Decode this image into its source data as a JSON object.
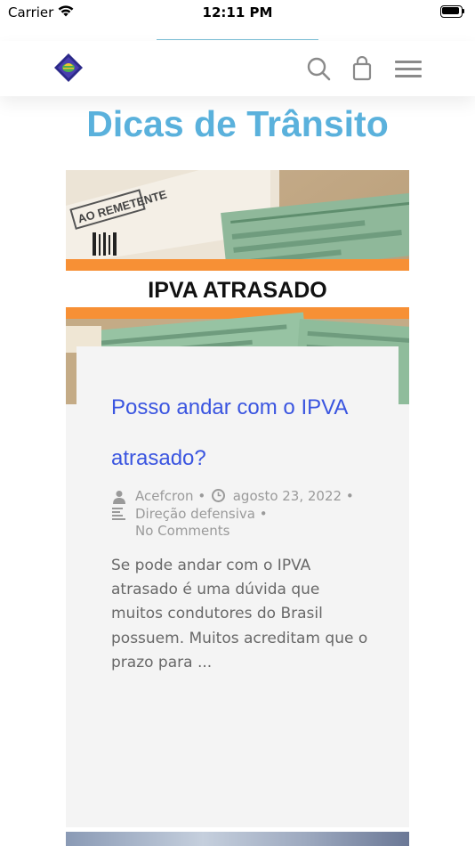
{
  "status_bar": {
    "carrier": "Carrier",
    "time": "12:11 PM"
  },
  "header": {
    "logo_icon": "diamond-logo-icon",
    "search_icon": "search-icon",
    "cart_icon": "shopping-bag-icon",
    "menu_icon": "hamburger-menu-icon"
  },
  "page": {
    "title": "Dicas de Trânsito"
  },
  "post": {
    "image": {
      "banner_text": "IPVA ATRASADO",
      "stamp_text": "AO REMETENTE"
    },
    "title": "Posso andar com o IPVA atrasado?",
    "author": "Acefcron",
    "date": "agosto 23, 2022",
    "category": "Direção defensiva",
    "comments": "No Comments",
    "separator": "•",
    "excerpt": "Se pode andar com o IPVA atrasado é uma dúvida que muitos condutores do Brasil possuem. Muitos acreditam que o prazo para ..."
  },
  "colors": {
    "title": "#5ab1dc",
    "post_link": "#3a55e0",
    "banner_orange": "#f79035"
  }
}
